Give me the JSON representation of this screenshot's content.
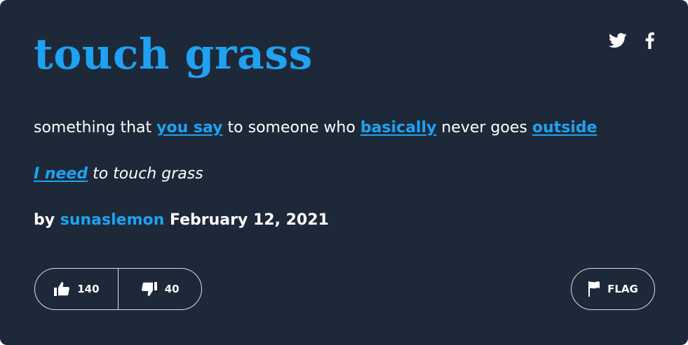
{
  "entry": {
    "word": "touch grass",
    "meaning": {
      "t1": "something that ",
      "link1": "you say",
      "t2": " to someone who ",
      "link2": "basically",
      "t3": " never goes ",
      "link3": "outside"
    },
    "example": {
      "link": "I need",
      "text": " to touch grass"
    },
    "contributor": {
      "by": "by",
      "author": "sunaslemon",
      "date": "February 12, 2021"
    },
    "votes": {
      "up": "140",
      "down": "40"
    },
    "flag_label": "FLAG"
  },
  "icons": {
    "share_twitter": "twitter-icon",
    "share_facebook": "facebook-icon",
    "thumbs_up": "thumbs-up-icon",
    "thumbs_down": "thumbs-down-icon",
    "flag": "flag-icon"
  },
  "colors": {
    "background": "#1d2939",
    "accent": "#1fa2f1",
    "text": "#ffffff",
    "border": "#d9dde3"
  }
}
